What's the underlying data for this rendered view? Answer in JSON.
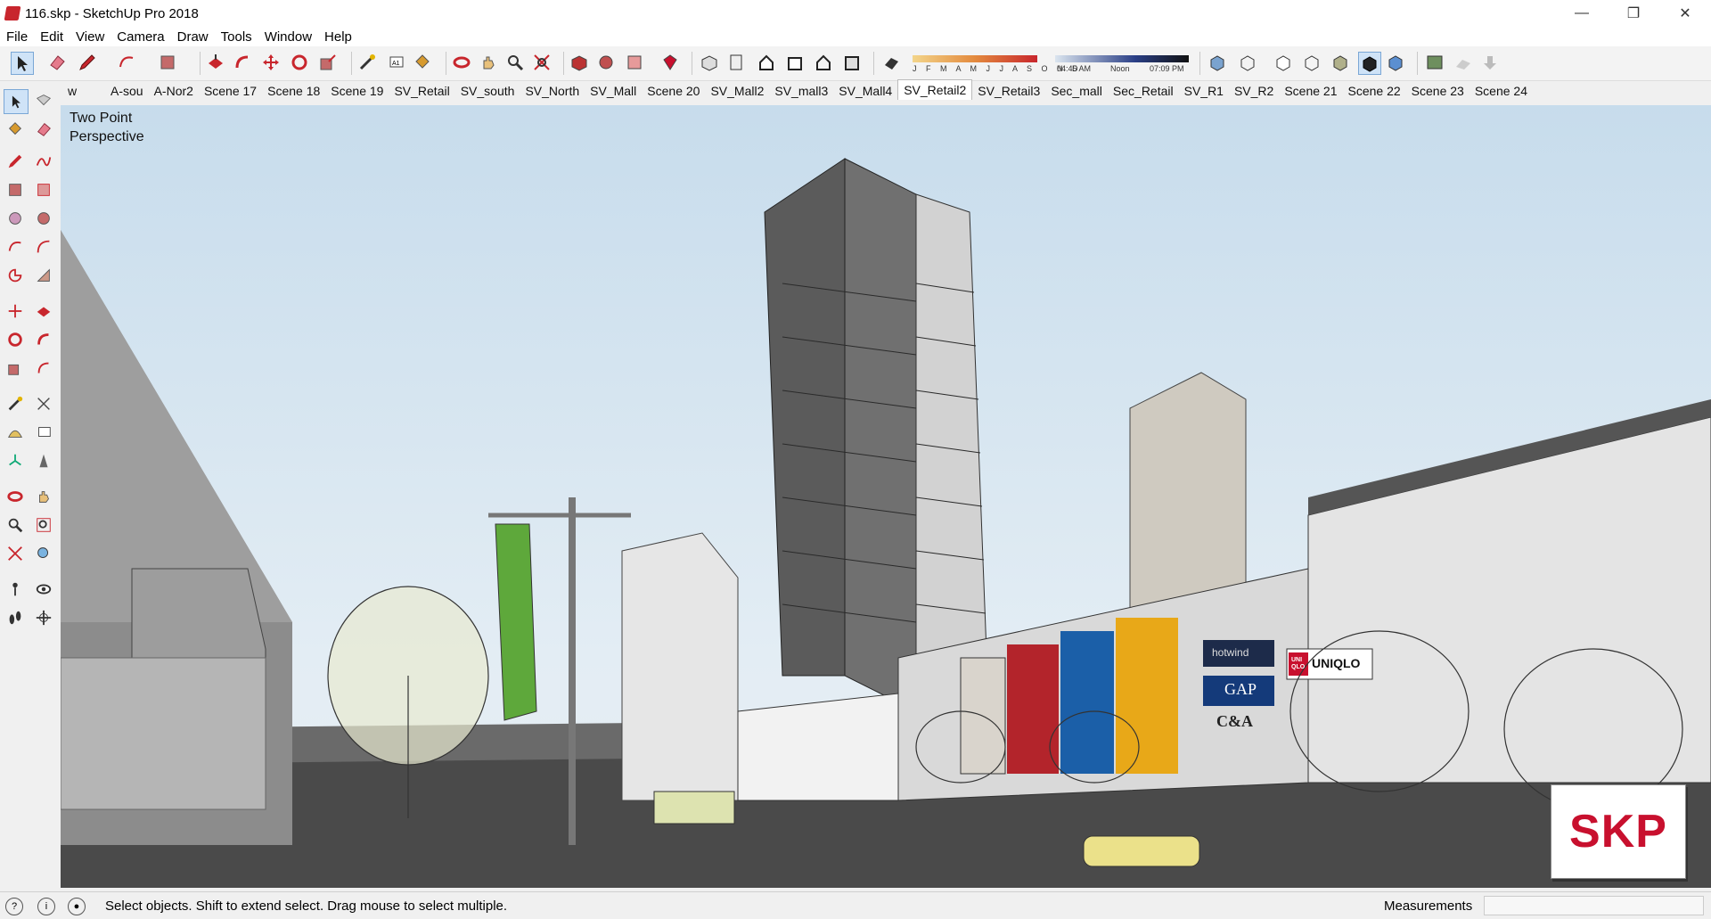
{
  "window": {
    "title": "116.skp - SketchUp Pro 2018",
    "minimize": "—",
    "restore": "❐",
    "close": "✕"
  },
  "menu": [
    "File",
    "Edit",
    "View",
    "Camera",
    "Draw",
    "Tools",
    "Window",
    "Help"
  ],
  "shadow": {
    "months": "J F M A M J J A S O N D",
    "time_start": "04:45 AM",
    "time_mid": "Noon",
    "time_end": "07:09 PM"
  },
  "scene_tabs": [
    "w",
    "A-sou",
    "A-Nor2",
    "Scene 17",
    "Scene 18",
    "Scene 19",
    "SV_Retail",
    "SV_south",
    "SV_North",
    "SV_Mall",
    "Scene 20",
    "SV_Mall2",
    "SV_mall3",
    "SV_Mall4",
    "SV_Retail2",
    "SV_Retail3",
    "Sec_mall",
    "Sec_Retail",
    "SV_R1",
    "SV_R2",
    "Scene 21",
    "Scene 22",
    "Scene 23",
    "Scene 24"
  ],
  "active_tab": "SV_Retail2",
  "viewport": {
    "camera_label": "Two Point\nPerspective",
    "badge": "SKP",
    "signs": {
      "hotwind": "hotwind",
      "gap": "GAP",
      "uniqlo": "UNIQLO",
      "uniqlo_mark": "UNI QLO",
      "ca": "C&A"
    }
  },
  "status": {
    "text": "Select objects. Shift to extend select. Drag mouse to select multiple.",
    "measurements_label": "Measurements"
  },
  "colors": {
    "accent": "#c8102e",
    "sky_top": "#c7dcec",
    "road": "#4a4a4a"
  }
}
